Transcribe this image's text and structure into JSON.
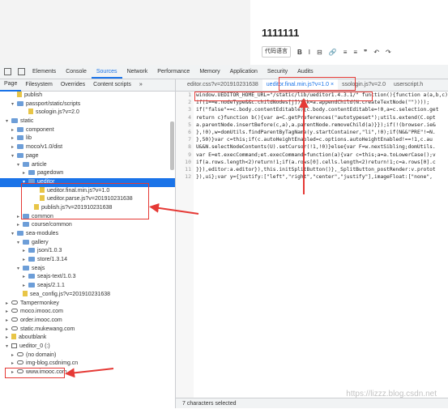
{
  "editor": {
    "title": "1111111",
    "font_select": "代码语言",
    "toolbar_glyphs": [
      "B",
      "I",
      "⊟",
      "🔗",
      "≡",
      "≡",
      "❞",
      "↶",
      "↷"
    ]
  },
  "devtools_tabs": [
    "Elements",
    "Console",
    "Sources",
    "Network",
    "Performance",
    "Memory",
    "Application",
    "Security",
    "Audits"
  ],
  "nav_tabs": [
    "Page",
    "Filesystem",
    "Overrides",
    "Content scripts",
    "»"
  ],
  "code_tabs": [
    "editor.css?v=201910231638",
    "ueditor.final.min.js?v=1.0 ×",
    "ssologin.js?v=2.0",
    "userscript.h"
  ],
  "tree": [
    {
      "indent": 14,
      "arrow": "",
      "icon": "file",
      "label": "publish"
    },
    {
      "indent": 14,
      "arrow": "▾",
      "icon": "folder",
      "label": "passport/static/scripts"
    },
    {
      "indent": 28,
      "arrow": "",
      "icon": "file",
      "label": "ssologin.js?v=2.0"
    },
    {
      "indent": 7,
      "arrow": "▾",
      "icon": "folder",
      "label": "static"
    },
    {
      "indent": 14,
      "arrow": "▸",
      "icon": "folder",
      "label": "component"
    },
    {
      "indent": 14,
      "arrow": "▸",
      "icon": "folder",
      "label": "lib"
    },
    {
      "indent": 14,
      "arrow": "▸",
      "icon": "folder",
      "label": "moco/v1.0/dist"
    },
    {
      "indent": 14,
      "arrow": "▾",
      "icon": "folder",
      "label": "page"
    },
    {
      "indent": 21,
      "arrow": "▾",
      "icon": "folder",
      "label": "article"
    },
    {
      "indent": 28,
      "arrow": "▸",
      "icon": "folder",
      "label": "pagedown"
    },
    {
      "indent": 28,
      "arrow": "▾",
      "icon": "folder",
      "label": "ueditor",
      "sel": true
    },
    {
      "indent": 42,
      "arrow": "",
      "icon": "file",
      "label": "ueditor.final.min.js?v=1.0"
    },
    {
      "indent": 42,
      "arrow": "",
      "icon": "file",
      "label": "ueditor.parse.js?v=201910231638"
    },
    {
      "indent": 35,
      "arrow": "",
      "icon": "file",
      "label": "publish.js?v=201910231638"
    },
    {
      "indent": 21,
      "arrow": "▸",
      "icon": "folder",
      "label": "common"
    },
    {
      "indent": 21,
      "arrow": "▸",
      "icon": "folder",
      "label": "course/common"
    },
    {
      "indent": 14,
      "arrow": "▾",
      "icon": "folder",
      "label": "sea-modules"
    },
    {
      "indent": 21,
      "arrow": "▾",
      "icon": "folder",
      "label": "gallery"
    },
    {
      "indent": 28,
      "arrow": "▸",
      "icon": "folder",
      "label": "json/1.0.3"
    },
    {
      "indent": 28,
      "arrow": "▸",
      "icon": "folder",
      "label": "store/1.3.14"
    },
    {
      "indent": 21,
      "arrow": "▾",
      "icon": "folder",
      "label": "seajs"
    },
    {
      "indent": 28,
      "arrow": "▸",
      "icon": "folder",
      "label": "seajs-text/1.0.3"
    },
    {
      "indent": 28,
      "arrow": "▸",
      "icon": "folder",
      "label": "seajs/2.1.1"
    },
    {
      "indent": 21,
      "arrow": "",
      "icon": "file",
      "label": "sea_config.js?v=201910231638"
    },
    {
      "indent": 7,
      "arrow": "▸",
      "icon": "cloud",
      "label": "Tampermonkey"
    },
    {
      "indent": 7,
      "arrow": "▸",
      "icon": "cloud",
      "label": "moco.imooc.com"
    },
    {
      "indent": 7,
      "arrow": "▸",
      "icon": "cloud",
      "label": "order.imooc.com"
    },
    {
      "indent": 7,
      "arrow": "▸",
      "icon": "cloud",
      "label": "static.mukewang.com"
    },
    {
      "indent": 7,
      "arrow": "▸",
      "icon": "file",
      "label": "aboutblank"
    },
    {
      "indent": 7,
      "arrow": "▾",
      "icon": "frame",
      "label": "ueditor_0 (:)"
    },
    {
      "indent": 14,
      "arrow": "▸",
      "icon": "cloud",
      "label": "(no domain)"
    },
    {
      "indent": 14,
      "arrow": "▸",
      "icon": "cloud",
      "label": "img-blog.csdnimg.cn"
    },
    {
      "indent": 14,
      "arrow": "▸",
      "icon": "cloud",
      "label": "www.imooc.com"
    }
  ],
  "code_lines": [
    "window.UEDITOR_HOME_URL=\"/static/lib/ueditor1.4.3.1/\" function(){function a(a,b,c)",
    "if(1==e.nodeType&&c.childNodes[j]){(k=a.appendChild(N.createTextNode(\"\"))));",
    "if(\"false\"==c.body.contentEditable){c.body.contentEditable=!0,a=c.selection.get",
    "return c}function b(){var a=C.getPreferences(\"autotypeset\");utils.extend(C.opt",
    "a.parentNode.insertBefore(c,a),a.parentNode.removeChild(a)}});if(!(browser.ie&",
    "},!0),w=domUtils.findParentByTagName(y.startContainer,\"li\",!0);if(N&&\"PRE\"!=N.",
    "},50)}var c=this;if(c.autoHeightEnabled=c.options.autoHeightEnabled!==!1,c.au",
    "U&&N.selectNodeContents(U).setCursor(!1,!0)}else{var F=w.nextSibling;domUtils.",
    "var E=et.execCommand;et.execCommand=function(a){var c=this;a=a.toLowerCase();v",
    "if(a.rows.length<2)return!1;if(a.rows[0].cells.length<2)return!1;c=a.rows[0].c",
    "}}),editor:a.editor}),this.initSplitButton()},_SplitButton_postRender:v.protot",
    "}),ui};var y={justify:[\"left\",\"right\",\"center\",\"justify\"],imageFloat:[\"none\","
  ],
  "status_text": "7 characters selected",
  "watermark": "https://lizzz.blog.csdn.net"
}
